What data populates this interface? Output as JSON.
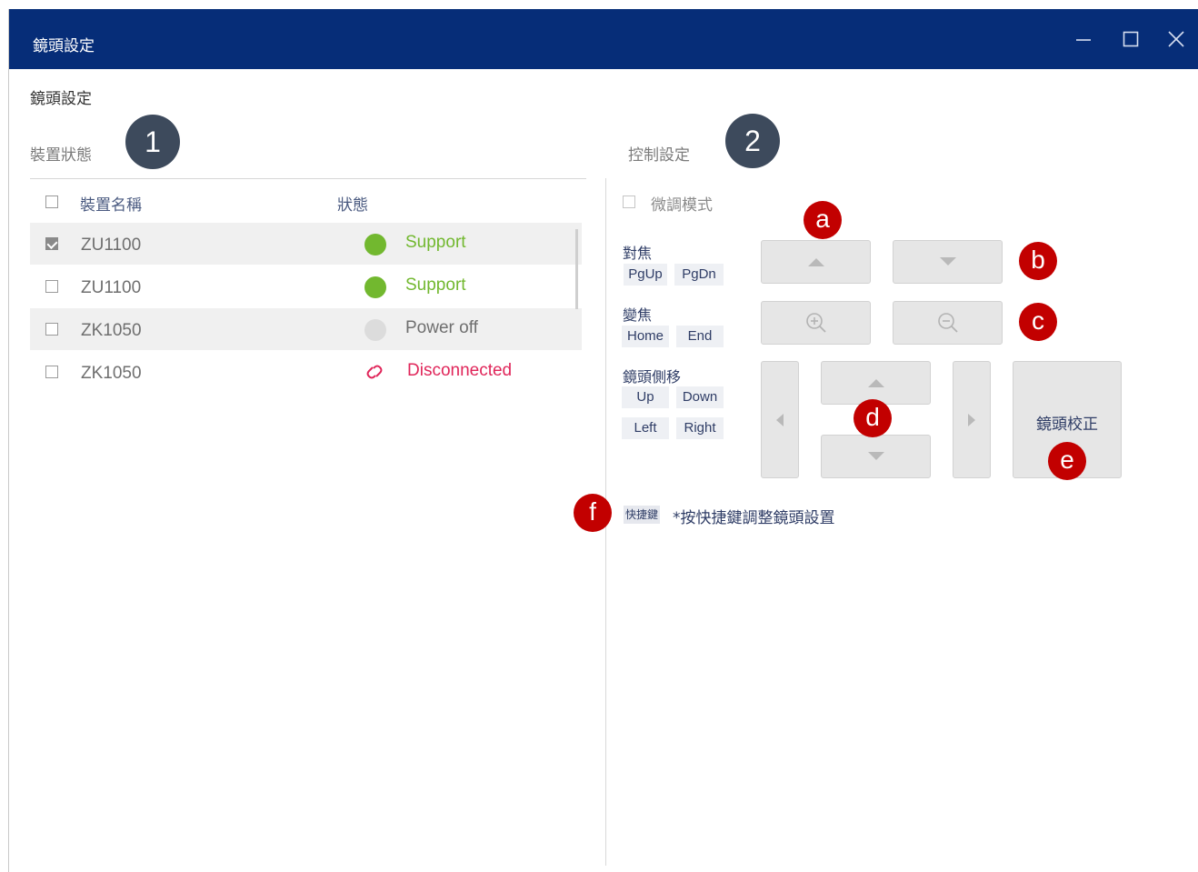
{
  "window": {
    "title": "鏡頭設定",
    "controls": {
      "minimize": "−",
      "maximize": "☐",
      "close": "✕"
    }
  },
  "page": {
    "heading": "鏡頭設定"
  },
  "markers": {
    "n1": "1",
    "n2": "2",
    "a": "a",
    "b": "b",
    "c": "c",
    "d": "d",
    "e": "e",
    "f": "f"
  },
  "device_panel": {
    "label": "裝置狀態",
    "columns": {
      "name": "裝置名稱",
      "status": "狀態"
    },
    "rows": [
      {
        "name": "ZU1100",
        "status": "Support",
        "checked": true,
        "status_color": "#72b82f"
      },
      {
        "name": "ZU1100",
        "status": "Support",
        "checked": false,
        "status_color": "#72b82f"
      },
      {
        "name": "ZK1050",
        "status": "Power off",
        "checked": false,
        "status_color": "#dcdcdc"
      },
      {
        "name": "ZK1050",
        "status": "Disconnected",
        "checked": false,
        "status_color": "#e0265a"
      }
    ]
  },
  "control_panel": {
    "label": "控制設定",
    "fine_mode": "微調模式",
    "focus": {
      "label": "對焦",
      "keys": [
        "PgUp",
        "PgDn"
      ]
    },
    "zoom": {
      "label": "變焦",
      "keys": [
        "Home",
        "End"
      ]
    },
    "pan": {
      "label": "鏡頭側移",
      "keys": [
        "Up",
        "Down",
        "Left",
        "Right"
      ]
    },
    "calibrate_label": "鏡頭校正",
    "hotkey_tag": "快捷鍵",
    "hotkey_note": "*按快捷鍵調整鏡頭設置"
  },
  "colors": {
    "titlebar": "#062d78",
    "marker_dark": "#3d4a5c",
    "marker_red": "#c20000",
    "support": "#72b82f",
    "disconnected": "#e0265a"
  },
  "icons": [
    "minimize-icon",
    "maximize-icon",
    "close-icon",
    "arrow-up-icon",
    "arrow-down-icon",
    "zoom-in-icon",
    "zoom-out-icon",
    "arrow-left-icon",
    "arrow-right-icon",
    "unlink-icon"
  ]
}
